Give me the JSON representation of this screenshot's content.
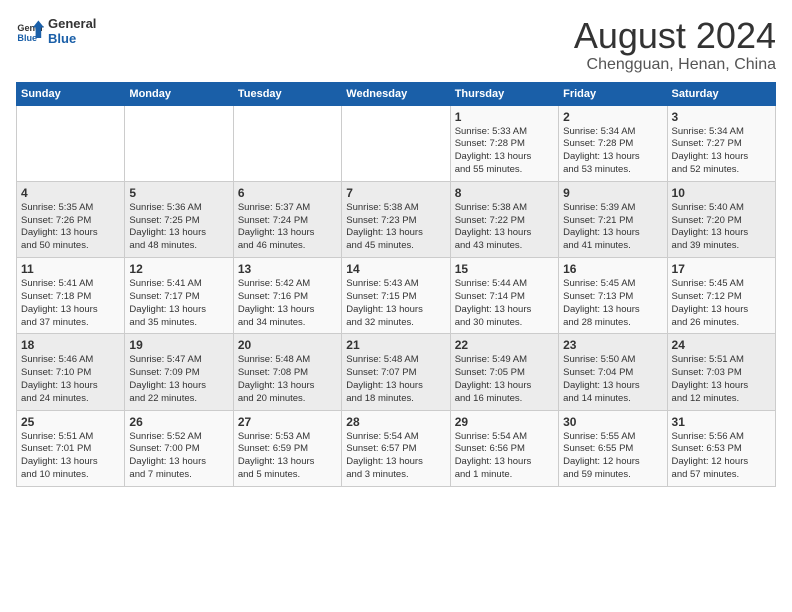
{
  "logo": {
    "text_general": "General",
    "text_blue": "Blue"
  },
  "title": "August 2024",
  "subtitle": "Chengguan, Henan, China",
  "days_of_week": [
    "Sunday",
    "Monday",
    "Tuesday",
    "Wednesday",
    "Thursday",
    "Friday",
    "Saturday"
  ],
  "weeks": [
    [
      {
        "day": "",
        "info": ""
      },
      {
        "day": "",
        "info": ""
      },
      {
        "day": "",
        "info": ""
      },
      {
        "day": "",
        "info": ""
      },
      {
        "day": "1",
        "info": "Sunrise: 5:33 AM\nSunset: 7:28 PM\nDaylight: 13 hours\nand 55 minutes."
      },
      {
        "day": "2",
        "info": "Sunrise: 5:34 AM\nSunset: 7:28 PM\nDaylight: 13 hours\nand 53 minutes."
      },
      {
        "day": "3",
        "info": "Sunrise: 5:34 AM\nSunset: 7:27 PM\nDaylight: 13 hours\nand 52 minutes."
      }
    ],
    [
      {
        "day": "4",
        "info": "Sunrise: 5:35 AM\nSunset: 7:26 PM\nDaylight: 13 hours\nand 50 minutes."
      },
      {
        "day": "5",
        "info": "Sunrise: 5:36 AM\nSunset: 7:25 PM\nDaylight: 13 hours\nand 48 minutes."
      },
      {
        "day": "6",
        "info": "Sunrise: 5:37 AM\nSunset: 7:24 PM\nDaylight: 13 hours\nand 46 minutes."
      },
      {
        "day": "7",
        "info": "Sunrise: 5:38 AM\nSunset: 7:23 PM\nDaylight: 13 hours\nand 45 minutes."
      },
      {
        "day": "8",
        "info": "Sunrise: 5:38 AM\nSunset: 7:22 PM\nDaylight: 13 hours\nand 43 minutes."
      },
      {
        "day": "9",
        "info": "Sunrise: 5:39 AM\nSunset: 7:21 PM\nDaylight: 13 hours\nand 41 minutes."
      },
      {
        "day": "10",
        "info": "Sunrise: 5:40 AM\nSunset: 7:20 PM\nDaylight: 13 hours\nand 39 minutes."
      }
    ],
    [
      {
        "day": "11",
        "info": "Sunrise: 5:41 AM\nSunset: 7:18 PM\nDaylight: 13 hours\nand 37 minutes."
      },
      {
        "day": "12",
        "info": "Sunrise: 5:41 AM\nSunset: 7:17 PM\nDaylight: 13 hours\nand 35 minutes."
      },
      {
        "day": "13",
        "info": "Sunrise: 5:42 AM\nSunset: 7:16 PM\nDaylight: 13 hours\nand 34 minutes."
      },
      {
        "day": "14",
        "info": "Sunrise: 5:43 AM\nSunset: 7:15 PM\nDaylight: 13 hours\nand 32 minutes."
      },
      {
        "day": "15",
        "info": "Sunrise: 5:44 AM\nSunset: 7:14 PM\nDaylight: 13 hours\nand 30 minutes."
      },
      {
        "day": "16",
        "info": "Sunrise: 5:45 AM\nSunset: 7:13 PM\nDaylight: 13 hours\nand 28 minutes."
      },
      {
        "day": "17",
        "info": "Sunrise: 5:45 AM\nSunset: 7:12 PM\nDaylight: 13 hours\nand 26 minutes."
      }
    ],
    [
      {
        "day": "18",
        "info": "Sunrise: 5:46 AM\nSunset: 7:10 PM\nDaylight: 13 hours\nand 24 minutes."
      },
      {
        "day": "19",
        "info": "Sunrise: 5:47 AM\nSunset: 7:09 PM\nDaylight: 13 hours\nand 22 minutes."
      },
      {
        "day": "20",
        "info": "Sunrise: 5:48 AM\nSunset: 7:08 PM\nDaylight: 13 hours\nand 20 minutes."
      },
      {
        "day": "21",
        "info": "Sunrise: 5:48 AM\nSunset: 7:07 PM\nDaylight: 13 hours\nand 18 minutes."
      },
      {
        "day": "22",
        "info": "Sunrise: 5:49 AM\nSunset: 7:05 PM\nDaylight: 13 hours\nand 16 minutes."
      },
      {
        "day": "23",
        "info": "Sunrise: 5:50 AM\nSunset: 7:04 PM\nDaylight: 13 hours\nand 14 minutes."
      },
      {
        "day": "24",
        "info": "Sunrise: 5:51 AM\nSunset: 7:03 PM\nDaylight: 13 hours\nand 12 minutes."
      }
    ],
    [
      {
        "day": "25",
        "info": "Sunrise: 5:51 AM\nSunset: 7:01 PM\nDaylight: 13 hours\nand 10 minutes."
      },
      {
        "day": "26",
        "info": "Sunrise: 5:52 AM\nSunset: 7:00 PM\nDaylight: 13 hours\nand 7 minutes."
      },
      {
        "day": "27",
        "info": "Sunrise: 5:53 AM\nSunset: 6:59 PM\nDaylight: 13 hours\nand 5 minutes."
      },
      {
        "day": "28",
        "info": "Sunrise: 5:54 AM\nSunset: 6:57 PM\nDaylight: 13 hours\nand 3 minutes."
      },
      {
        "day": "29",
        "info": "Sunrise: 5:54 AM\nSunset: 6:56 PM\nDaylight: 13 hours\nand 1 minute."
      },
      {
        "day": "30",
        "info": "Sunrise: 5:55 AM\nSunset: 6:55 PM\nDaylight: 12 hours\nand 59 minutes."
      },
      {
        "day": "31",
        "info": "Sunrise: 5:56 AM\nSunset: 6:53 PM\nDaylight: 12 hours\nand 57 minutes."
      }
    ]
  ]
}
